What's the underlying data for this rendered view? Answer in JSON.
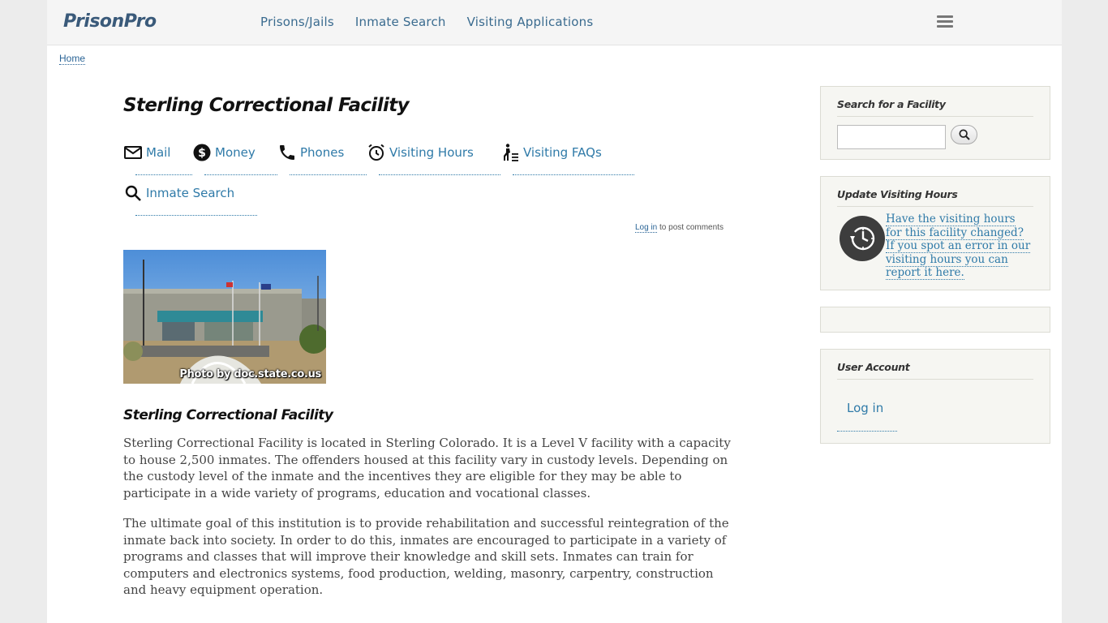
{
  "header": {
    "logo": "PrisonPro",
    "nav": [
      "Prisons/Jails",
      "Inmate Search",
      "Visiting Applications"
    ]
  },
  "breadcrumb": {
    "home": "Home"
  },
  "page": {
    "title": "Sterling Correctional Facility",
    "tabs": [
      {
        "label": "Mail",
        "icon": "mail-icon"
      },
      {
        "label": "Money",
        "icon": "money-icon"
      },
      {
        "label": "Phones",
        "icon": "phone-icon"
      },
      {
        "label": "Visiting Hours",
        "icon": "alarm-clock-icon"
      },
      {
        "label": "Visiting FAQs",
        "icon": "visitor-icon"
      },
      {
        "label": "Inmate Search",
        "icon": "search-icon"
      }
    ],
    "login_note": {
      "link": "Log in",
      "text": " to post comments"
    },
    "photo_credit": "Photo by doc.state.co.us",
    "subtitle": "Sterling Correctional Facility",
    "paragraph1": "Sterling Correctional Facility is located in Sterling Colorado.  It is a Level V facility with a capacity to house 2,500 inmates.  The offenders housed at this facility vary in custody levels.  Depending on the custody level of the inmate and the incentives they are eligible for they may be able to participate in a wide variety of programs, education and vocational classes.",
    "paragraph2": "The ultimate goal of this institution is to provide rehabilitation and successful reintegration of the inmate back into society.  In order to do this, inmates are encouraged to participate in a variety of programs and classes that will improve their knowledge and skill sets.  Inmates can train for computers and electronics systems, food production, welding, masonry, carpentry, construction and heavy equipment operation."
  },
  "sidebar": {
    "search": {
      "title": "Search for a Facility",
      "value": ""
    },
    "update": {
      "title": "Update Visiting Hours",
      "link": "Have the visiting hours for this facility changed?  If you spot an error in our visiting hours you can report it here."
    },
    "account": {
      "title": "User Account",
      "login": "Log in"
    }
  },
  "colors": {
    "link": "#2f7aa8",
    "nav": "#3a6b8f",
    "logo": "#3a5a7a",
    "sidebar_bg": "#f6f6f2"
  }
}
